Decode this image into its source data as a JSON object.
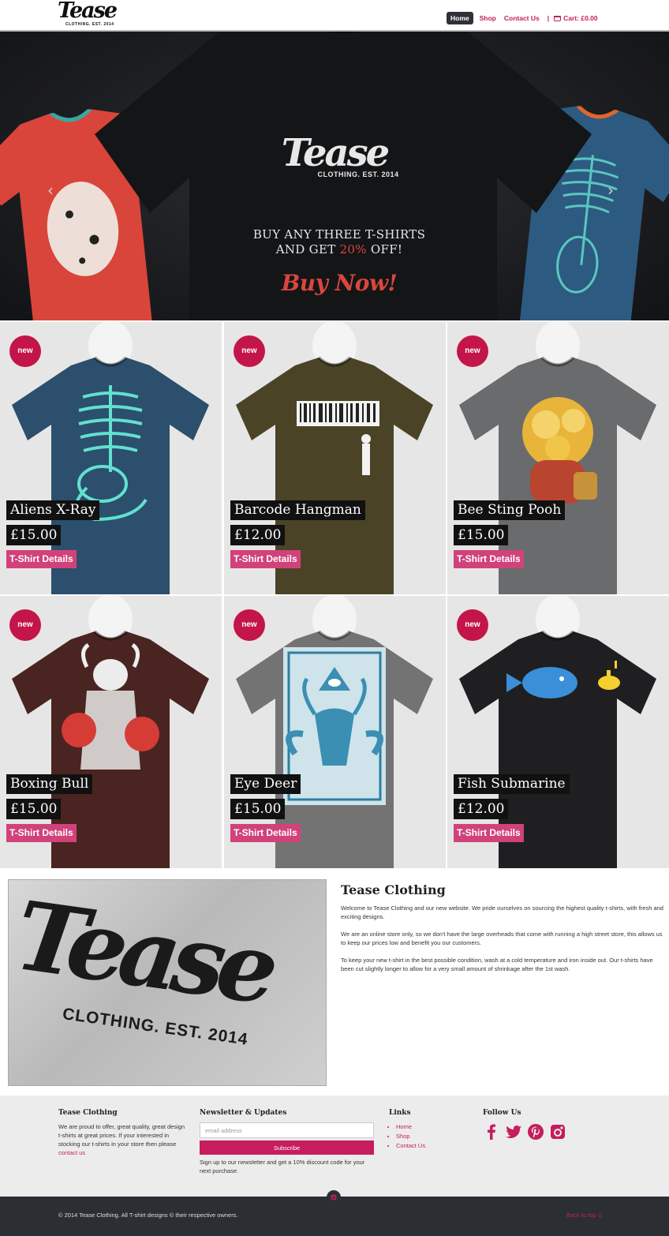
{
  "header": {
    "logo_text": "Tease",
    "logo_subtext": "CLOTHING. EST. 2014",
    "nav": [
      {
        "label": "Home",
        "active": true
      },
      {
        "label": "Shop",
        "active": false
      },
      {
        "label": "Contact Us",
        "active": false
      }
    ],
    "nav_separator": "|",
    "cart_label": "Cart: £0.00"
  },
  "hero": {
    "brand": "Tease",
    "brand_sub": "CLOTHING. EST. 2014",
    "line1": "BUY ANY THREE T-SHIRTS",
    "line2_prefix": "AND GET ",
    "line2_accent": "20%",
    "line2_suffix": " OFF!",
    "cta": "Buy Now!",
    "prev_arrow": "‹",
    "next_arrow": "›",
    "slide_count": 2,
    "active_slide": 1,
    "accent_color": "#d8473e"
  },
  "products": [
    {
      "badge": "new",
      "name": "Aliens X-Ray",
      "price": "£15.00",
      "button": "T-Shirt Details",
      "shirt_color": "#2b4f6c",
      "print": "xray"
    },
    {
      "badge": "new",
      "name": "Barcode Hangman",
      "price": "£12.00",
      "button": "T-Shirt Details",
      "shirt_color": "#4a4326",
      "print": "barcode"
    },
    {
      "badge": "new",
      "name": "Bee Sting Pooh",
      "price": "£15.00",
      "button": "T-Shirt Details",
      "shirt_color": "#6a6b6d",
      "print": "pooh"
    },
    {
      "badge": "new",
      "name": "Boxing Bull",
      "price": "£15.00",
      "button": "T-Shirt Details",
      "shirt_color": "#4a2420",
      "print": "bull"
    },
    {
      "badge": "new",
      "name": "Eye Deer",
      "price": "£15.00",
      "button": "T-Shirt Details",
      "shirt_color": "#737373",
      "print": "deer"
    },
    {
      "badge": "new",
      "name": "Fish Submarine",
      "price": "£12.00",
      "button": "T-Shirt Details",
      "shirt_color": "#1f1f21",
      "print": "fish"
    }
  ],
  "about": {
    "image_logo": "Tease",
    "image_sub": "CLOTHING. EST. 2014",
    "title": "Tease Clothing",
    "paragraphs": [
      "Welcome to Tease Clothing and our new website. We pride ourselves on sourcing the highest quality t-shirts, with fresh and exciting designs.",
      "We are an online store only, so we don't have the large overheads that come with running a high street store, this allows us to keep our prices low and benefit you our customers.",
      "To keep your new t-shirt in the best possible condition, wash at a cold temperature and iron inside out. Our t-shirts have been cut slightly longer to allow for a very small amount of shrinkage after the 1st wash."
    ]
  },
  "footer": {
    "col1_title": "Tease Clothing",
    "col1_text": "We are proud to offer, great quality, great design t-shirts at great prices. If your interested in stocking our t-shirts in your store then please ",
    "col1_link": "contact us",
    "newsletter_title": "Newsletter & Updates",
    "email_placeholder": "email address",
    "subscribe_label": "Subscribe",
    "newsletter_text": "Sign up to our newsletter and get a 10% discount code for your next purchase.",
    "links_title": "Links",
    "links": [
      "Home",
      "Shop",
      "Contact Us"
    ],
    "follow_title": "Follow Us",
    "social": [
      "facebook-icon",
      "twitter-icon",
      "pinterest-icon",
      "instagram-icon"
    ],
    "copyright": "© 2014 Tease Clothing. All T-shirt designs © their respective owners.",
    "back_to_top": "Back to top",
    "brand_color": "#c51d5e"
  }
}
